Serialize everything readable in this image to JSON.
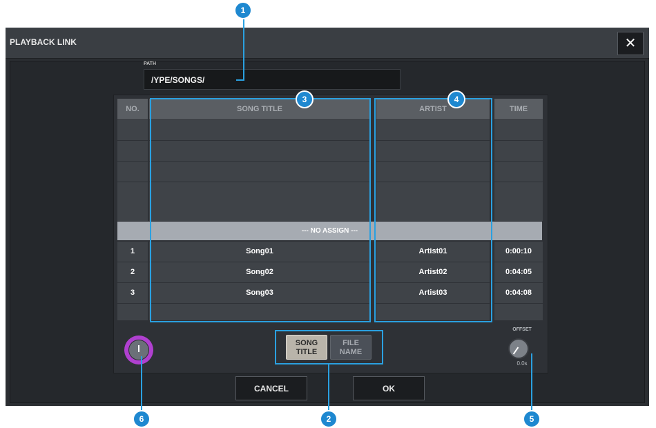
{
  "dialog": {
    "title": "PLAYBACK LINK",
    "close_glyph": "✕"
  },
  "path": {
    "label": "PATH",
    "value": "/YPE/SONGS/"
  },
  "table": {
    "columns": [
      "NO.",
      "SONG TITLE",
      "ARTIST",
      "TIME"
    ],
    "no_assign_label": "--- NO ASSIGN ---",
    "rows": [
      {
        "no": "1",
        "title": "Song01",
        "artist": "Artist01",
        "time": "0:00:10"
      },
      {
        "no": "2",
        "title": "Song02",
        "artist": "Artist02",
        "time": "0:04:05"
      },
      {
        "no": "3",
        "title": "Song03",
        "artist": "Artist03",
        "time": "0:04:08"
      }
    ]
  },
  "sort": {
    "song_title": "SONG TITLE",
    "file_name": "FILE NAME",
    "selected": "song_title"
  },
  "offset": {
    "label": "OFFSET",
    "value": "0.0s"
  },
  "footer": {
    "cancel": "CANCEL",
    "ok": "OK"
  },
  "callouts": [
    "1",
    "2",
    "3",
    "4",
    "5",
    "6"
  ],
  "colors": {
    "callout": "#1e88d0",
    "highlight": "#2aa0e0",
    "scroll_knob_ring": "#b040d0"
  },
  "icons": {
    "close": "close-icon",
    "scroll": "scroll-knob-icon",
    "offset": "offset-knob-icon"
  }
}
